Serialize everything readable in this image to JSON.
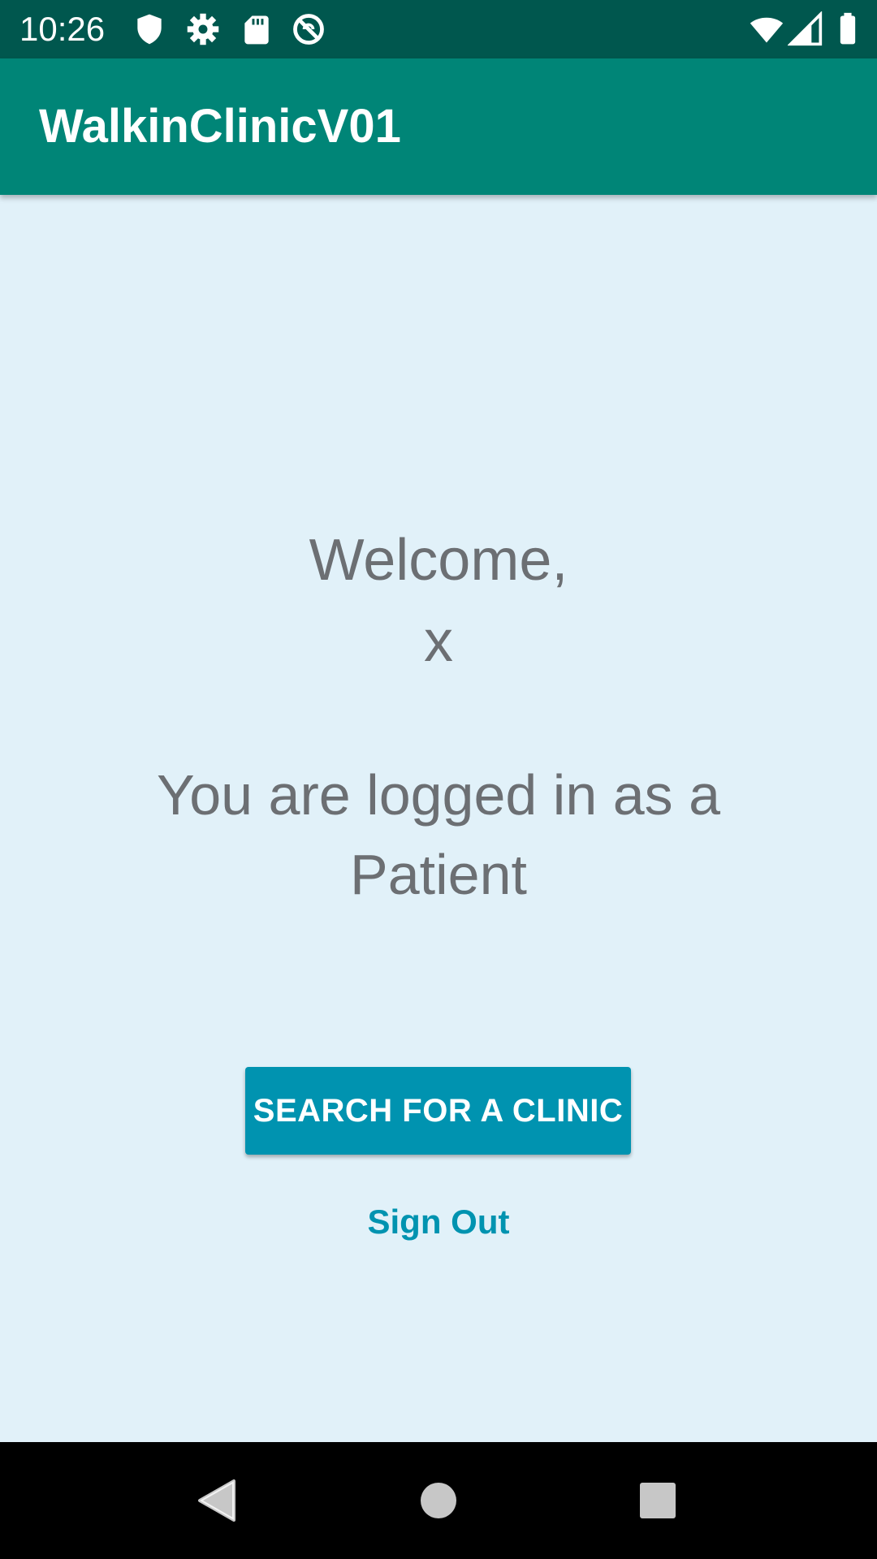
{
  "status_bar": {
    "time": "10:26",
    "icons": [
      "shield-icon",
      "gear-icon",
      "sd-card-icon",
      "do-not-disturb-icon",
      "wifi-icon",
      "signal-icon",
      "battery-icon"
    ]
  },
  "app_bar": {
    "title": "WalkinClinicV01",
    "color": "#008577"
  },
  "main": {
    "welcome_line": "Welcome,",
    "username": "x",
    "role_line1": "You are logged in as a",
    "role_line2": "Patient",
    "search_button_label": "SEARCH FOR A CLINIC",
    "signout_label": "Sign Out",
    "accent_color": "#0093b0",
    "background": "#e1f1f9"
  },
  "nav_bar": {
    "icons": [
      "back-icon",
      "home-icon",
      "recents-icon"
    ]
  }
}
